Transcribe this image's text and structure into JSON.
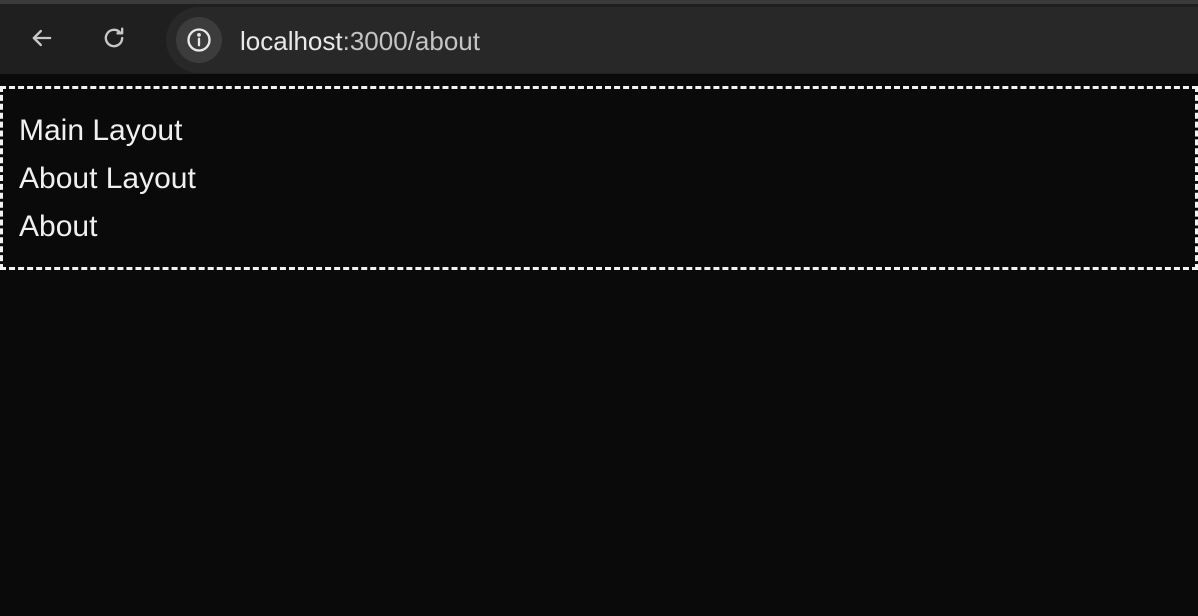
{
  "browser": {
    "url_host": "localhost",
    "url_path": ":3000/about",
    "icons": {
      "back": "arrow-left-icon",
      "reload": "reload-icon",
      "site_info": "info-icon"
    }
  },
  "page": {
    "lines": [
      "Main Layout",
      "About Layout",
      "About"
    ]
  },
  "colors": {
    "page_background": "#0a0a0a",
    "toolbar_background": "#1f1f1f",
    "omnibox_background": "#282828",
    "text": "#f0f0f0",
    "dashed_border": "#f2f2f2"
  }
}
